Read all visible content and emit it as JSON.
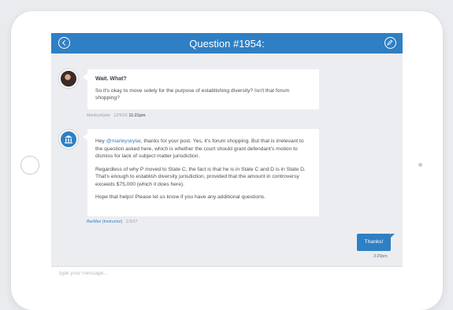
{
  "header": {
    "title": "Question #1954:"
  },
  "messages": [
    {
      "title": "Wait. What?",
      "body": "So it's okay to move solely for the purpose of establishing diversity? Isn't that forum shopping?",
      "author": "Marleyskylar",
      "date": "12/5/16",
      "time": "11:21pm"
    },
    {
      "greeting": "Hey ",
      "mention": "@marleyskylar",
      "p1_rest": ", thanks for your post. Yes, it's forum shopping. But that is irrelevant to the question asked here, which is whether the court should grant defendant's motion to dismiss for lack of subject matter jurisdiction.",
      "p2": "Regardless of why P moved to State C, the fact is that he is in State C and D is in State D. That's enough to establish diversity jurisdiction, provided that the amount in controversy exceeds $75,000 (which it does here).",
      "p3": "Hope that helps! Please let us know if you have any additional questions.",
      "author": "BarMax",
      "role": "(Instructor)",
      "date": "1/3/17"
    }
  ],
  "my_reply": {
    "text": "Thanks!",
    "time": "3:20pm"
  },
  "composer": {
    "placeholder": "type your message..."
  },
  "colors": {
    "accent": "#2f7fc4",
    "background": "#ecedf0"
  },
  "icons": {
    "back": "back-arrow-icon",
    "edit": "edit-icon",
    "instructor": "institution-icon"
  }
}
